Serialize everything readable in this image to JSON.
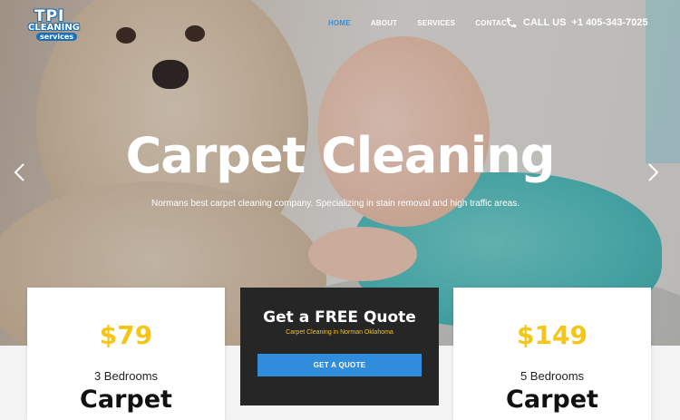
{
  "logo": {
    "top": "TPI",
    "middle": "CLEANING",
    "bottom": "services"
  },
  "nav": {
    "items": [
      {
        "label": "HOME",
        "active": true
      },
      {
        "label": "ABOUT",
        "active": false
      },
      {
        "label": "SERVICES",
        "active": false
      },
      {
        "label": "CONTACT",
        "active": false
      }
    ]
  },
  "phone": {
    "icon": "phone-icon",
    "label": "CALL US",
    "number": "+1 405-343-7025"
  },
  "hero": {
    "title": "Carpet Cleaning",
    "subtitle": "Normans best carpet cleaning company. Specializing in stain removal and high traffic areas."
  },
  "slider": {
    "prev_icon": "chevron-left-icon",
    "next_icon": "chevron-right-icon"
  },
  "cards": {
    "left": {
      "price": "$79",
      "bedrooms": "3 Bedrooms",
      "type": "Carpet"
    },
    "right": {
      "price": "$149",
      "bedrooms": "5 Bedrooms",
      "type": "Carpet"
    }
  },
  "quote": {
    "title": "Get a FREE Quote",
    "subtitle": "Carpet Cleaning in Norman Oklahoma",
    "button": "GET A QUOTE"
  },
  "colors": {
    "accent_blue": "#2f8ddb",
    "price_yellow": "#f5c518",
    "quote_bg": "#262626",
    "nav_active": "#3b8fd8"
  }
}
